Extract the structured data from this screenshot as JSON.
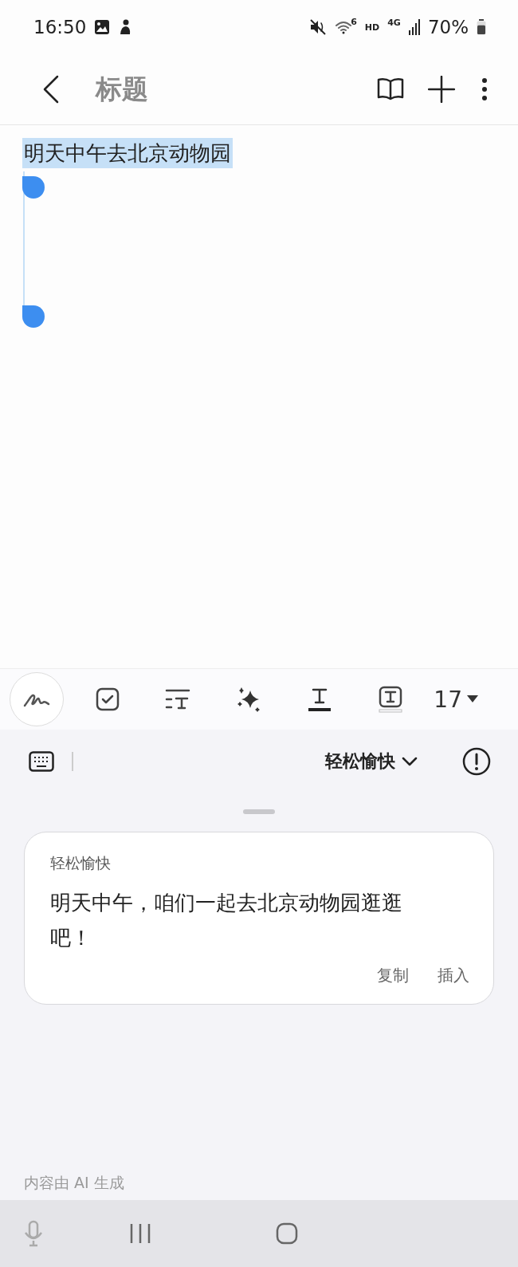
{
  "status_bar": {
    "time": "16:50",
    "wifi_band": "6",
    "hd": "HD",
    "network": "4G",
    "battery": "70%"
  },
  "app_bar": {
    "title": "标题"
  },
  "note": {
    "text": "明天中午去北京动物园",
    "selected": true
  },
  "toolbar": {
    "tools": [
      {
        "kind": "handwriting",
        "selected": true
      },
      {
        "kind": "checkbox",
        "selected": false
      },
      {
        "kind": "textstyle",
        "selected": false
      },
      {
        "kind": "ai",
        "selected": false
      },
      {
        "kind": "textcolor",
        "selected": false
      },
      {
        "kind": "highlight",
        "selected": false
      }
    ],
    "font_size": "17"
  },
  "assist": {
    "tone": "轻松愉快",
    "card": {
      "label": "轻松愉快",
      "text": "明天中午，咱们一起去北京动物园逛逛吧！",
      "actions": [
        "复制",
        "插入"
      ]
    },
    "footer": "内容由 AI 生成"
  }
}
